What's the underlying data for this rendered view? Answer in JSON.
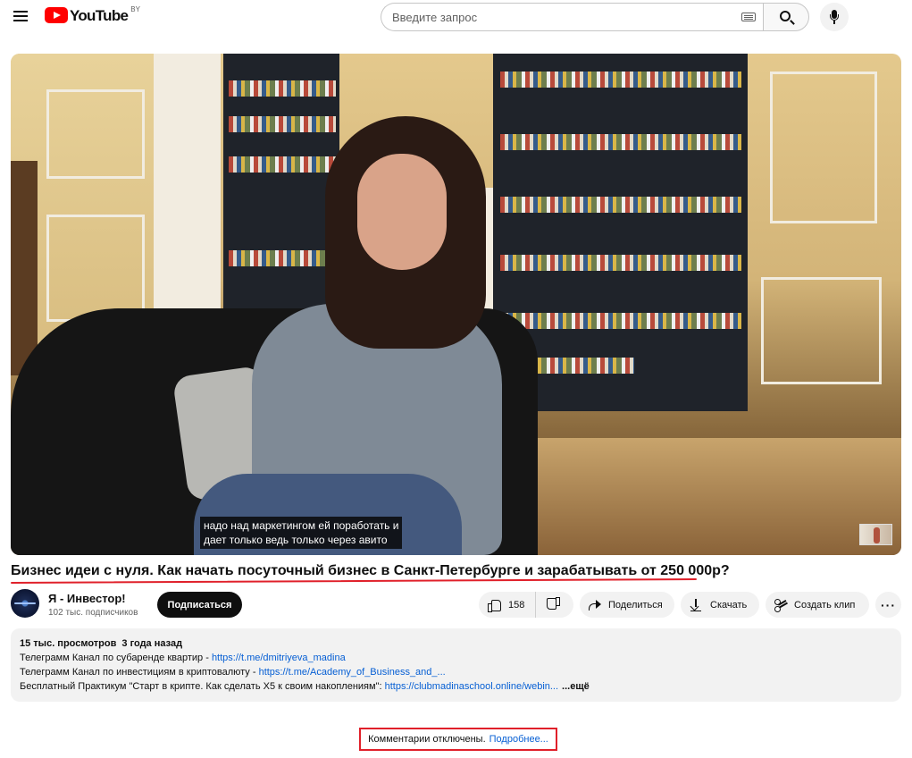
{
  "header": {
    "logo_text": "YouTube",
    "region": "BY",
    "search_placeholder": "Введите запрос"
  },
  "video": {
    "subtitle_lines": [
      "надо над маркетингом ей поработать и",
      "дает только ведь только через авито"
    ],
    "title": "Бизнес идеи с нуля. Как начать посуточный бизнес в Санкт-Петербурге и зарабатывать от 250 000р?"
  },
  "channel": {
    "name": "Я - Инвестор!",
    "subscribers": "102 тыс. подписчиков",
    "subscribe_label": "Подписаться"
  },
  "actions": {
    "likes": "158",
    "share_label": "Поделиться",
    "download_label": "Скачать",
    "clip_label": "Создать клип",
    "more_label": "···"
  },
  "description": {
    "views": "15 тыс. просмотров",
    "date": "3 года назад",
    "lines": [
      {
        "text": "Телеграмм Канал по субаренде квартир - ",
        "link": "https://t.me/dmitriyeva_madina"
      },
      {
        "text": "Телеграмм Канал по инвестициям в криптовалюту - ",
        "link": "https://t.me/Academy_of_Business_and_..."
      },
      {
        "text": "Бесплатный Практикум \"Старт в крипте. Как сделать Х5 к своим накоплениям\": ",
        "link": "https://clubmadinaschool.online/webin..."
      }
    ],
    "more_label": "...ещё"
  },
  "comments": {
    "disabled_text": "Комментарии отключены.",
    "learn_more": "Подробнее..."
  },
  "colors": {
    "brand_red": "#ff0000",
    "annotation_red": "#e0202a",
    "link_blue": "#065fd4"
  }
}
